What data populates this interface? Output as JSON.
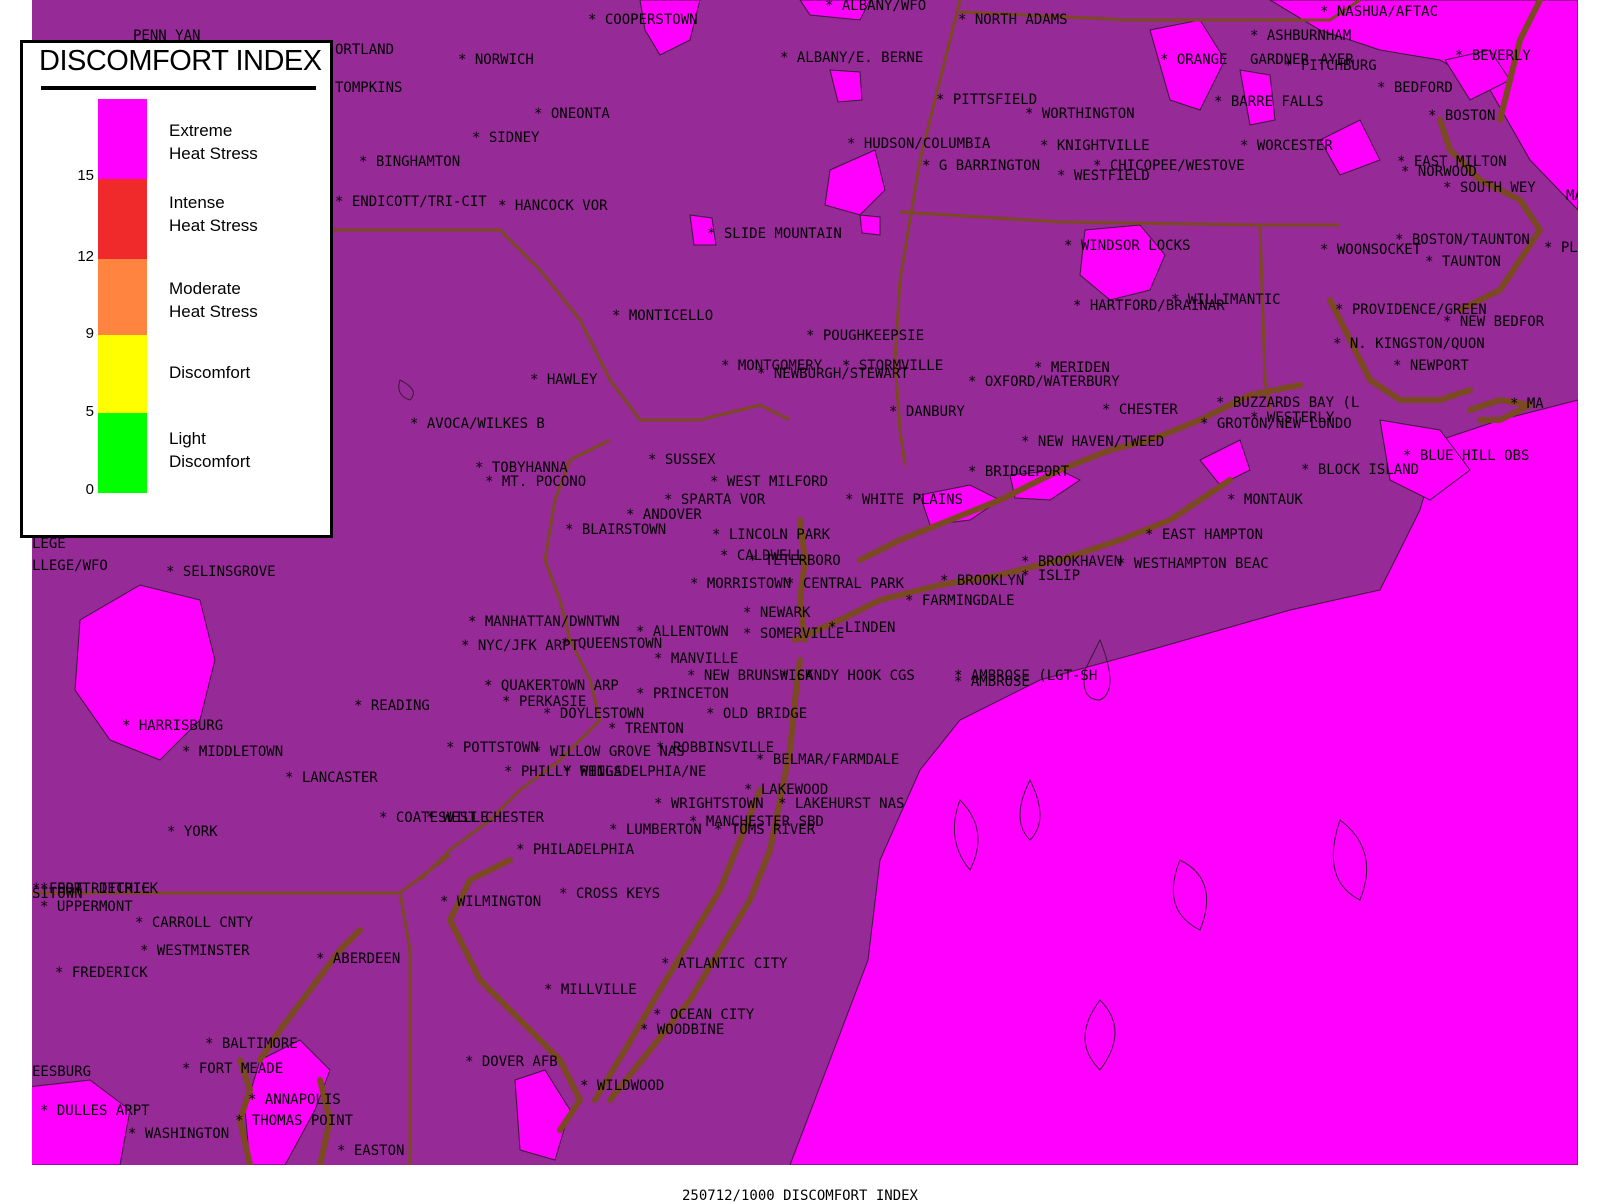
{
  "legend": {
    "title": "DISCOMFORT INDEX",
    "categories": [
      {
        "label": "Extreme\nHeat Stress",
        "color": "#ff00ff"
      },
      {
        "label": "Intense\nHeat Stress",
        "color": "#f02a2a"
      },
      {
        "label": "Moderate\nHeat Stress",
        "color": "#ff8440"
      },
      {
        "label": "Discomfort",
        "color": "#ffff00"
      },
      {
        "label": "Light\nDiscomfort",
        "color": "#00ff00"
      }
    ],
    "ticks": [
      "15",
      "12",
      "9",
      "5",
      "0"
    ]
  },
  "colors": {
    "background_level": "#962a96",
    "extreme_level": "#ff00ff",
    "state_borders": "#7a4a20",
    "coastline": "#7a4a20"
  },
  "caption": "250712/1000 DISCOMFORT INDEX",
  "stations": [
    {
      "name": "PENN YAN",
      "marker": false
    },
    {
      "name": "COOPERSTOWN",
      "marker": true
    },
    {
      "name": "ALBANY/WFO",
      "marker": true
    },
    {
      "name": "NORTH ADAMS",
      "marker": true
    },
    {
      "name": "NASHUA/AFTAC",
      "marker": true
    },
    {
      "name": "ASHBURNHAM",
      "marker": true
    },
    {
      "name": "ORTLAND",
      "marker": false
    },
    {
      "name": "NORWICH",
      "marker": true
    },
    {
      "name": "ALBANY/E. BERNE",
      "marker": true
    },
    {
      "name": "ORANGE",
      "marker": true
    },
    {
      "name": "GARDNER",
      "marker": false
    },
    {
      "name": "AYER",
      "marker": false
    },
    {
      "name": "FITCHBURG",
      "marker": true
    },
    {
      "name": "BEVERLY",
      "marker": true
    },
    {
      "name": "TOMPKINS",
      "marker": false
    },
    {
      "name": "BEDFORD",
      "marker": true
    },
    {
      "name": "PITTSFIELD",
      "marker": true
    },
    {
      "name": "BARRE FALLS",
      "marker": true
    },
    {
      "name": "ONEONTA",
      "marker": true
    },
    {
      "name": "WORTHINGTON",
      "marker": true
    },
    {
      "name": "BOSTON",
      "marker": true
    },
    {
      "name": "SIDNEY",
      "marker": true
    },
    {
      "name": "HUDSON/COLUMBIA",
      "marker": true
    },
    {
      "name": "KNIGHTVILLE",
      "marker": true
    },
    {
      "name": "WORCESTER",
      "marker": true
    },
    {
      "name": "BINGHAMTON",
      "marker": true
    },
    {
      "name": "G BARRINGTON",
      "marker": true
    },
    {
      "name": "CHICOPEE/WESTOVE",
      "marker": true
    },
    {
      "name": "EAST MILTON",
      "marker": true
    },
    {
      "name": "NORWOOD",
      "marker": true
    },
    {
      "name": "WESTFIELD",
      "marker": true
    },
    {
      "name": "SOUTH WEY",
      "marker": true
    },
    {
      "name": "ENDICOTT/TRI-CIT",
      "marker": true
    },
    {
      "name": "HANCOCK VOR",
      "marker": true
    },
    {
      "name": "MAR",
      "marker": false
    },
    {
      "name": "SLIDE MOUNTAIN",
      "marker": true
    },
    {
      "name": "BOSTON/TAUNTON",
      "marker": true
    },
    {
      "name": "PLYM",
      "marker": true
    },
    {
      "name": "WINDSOR LOCKS",
      "marker": true
    },
    {
      "name": "WOONSOCKET",
      "marker": true
    },
    {
      "name": "TAUNTON",
      "marker": true
    },
    {
      "name": "HARTFORD/BRAINAR",
      "marker": true
    },
    {
      "name": "WILLIMANTIC",
      "marker": true
    },
    {
      "name": "PROVIDENCE/GREEN",
      "marker": true
    },
    {
      "name": "MONTICELLO",
      "marker": true
    },
    {
      "name": "NEW BEDFOR",
      "marker": true
    },
    {
      "name": "POUGHKEEPSIE",
      "marker": true
    },
    {
      "name": "N. KINGSTON/QUON",
      "marker": true
    },
    {
      "name": "MONTGOMERY",
      "marker": true
    },
    {
      "name": "STORMVILLE",
      "marker": true
    },
    {
      "name": "NEWPORT",
      "marker": true
    },
    {
      "name": "NEWBURGH/STEWART",
      "marker": true
    },
    {
      "name": "MERIDEN",
      "marker": true
    },
    {
      "name": "HAWLEY",
      "marker": true
    },
    {
      "name": "OXFORD/WATERBURY",
      "marker": true
    },
    {
      "name": "BUZZARDS BAY (L",
      "marker": true
    },
    {
      "name": "MA",
      "marker": true
    },
    {
      "name": "DANBURY",
      "marker": true
    },
    {
      "name": "CHESTER",
      "marker": true
    },
    {
      "name": "WESTERLY",
      "marker": true
    },
    {
      "name": "AVOCA/WILKES B",
      "marker": true
    },
    {
      "name": "GROTON/NEW LONDO",
      "marker": true
    },
    {
      "name": "NEW HAVEN/TWEED",
      "marker": true
    },
    {
      "name": "BLUE HILL OBS",
      "marker": true
    },
    {
      "name": "TOBYHANNA",
      "marker": true
    },
    {
      "name": "SUSSEX",
      "marker": true
    },
    {
      "name": "BRIDGEPORT",
      "marker": true
    },
    {
      "name": "BLOCK ISLAND",
      "marker": true
    },
    {
      "name": "MT. POCONO",
      "marker": true
    },
    {
      "name": "WEST MILFORD",
      "marker": true
    },
    {
      "name": "SPARTA VOR",
      "marker": true
    },
    {
      "name": "WHITE PLAINS",
      "marker": true
    },
    {
      "name": "MONTAUK",
      "marker": true
    },
    {
      "name": "ANDOVER",
      "marker": true
    },
    {
      "name": "BLAIRSTOWN",
      "marker": true
    },
    {
      "name": "LINCOLN PARK",
      "marker": true
    },
    {
      "name": "EAST HAMPTON",
      "marker": true
    },
    {
      "name": "CALDWELL",
      "marker": true
    },
    {
      "name": "TETERBORO",
      "marker": true
    },
    {
      "name": "BROOKHAVEN",
      "marker": true
    },
    {
      "name": "WESTHAMPTON BEAC",
      "marker": true
    },
    {
      "name": "LEGE",
      "marker": false
    },
    {
      "name": "LLEGE/WFO",
      "marker": false
    },
    {
      "name": "SELINSGROVE",
      "marker": true
    },
    {
      "name": "ISLIP",
      "marker": true
    },
    {
      "name": "MORRISTOWN",
      "marker": true
    },
    {
      "name": "CENTRAL PARK",
      "marker": true
    },
    {
      "name": "BROOKLYN",
      "marker": true
    },
    {
      "name": "FARMINGDALE",
      "marker": true
    },
    {
      "name": "NEWARK",
      "marker": true
    },
    {
      "name": "MANHATTAN/DWNTWN",
      "marker": true
    },
    {
      "name": "ALLENTOWN",
      "marker": true
    },
    {
      "name": "SOMERVILLE",
      "marker": true
    },
    {
      "name": "LINDEN",
      "marker": true
    },
    {
      "name": "NYC/JFK ARPT",
      "marker": true
    },
    {
      "name": "QUEENSTOWN",
      "marker": true
    },
    {
      "name": "MANVILLE",
      "marker": true
    },
    {
      "name": "NEW BRUNSWICK",
      "marker": true
    },
    {
      "name": "SANDY HOOK CGS",
      "marker": true
    },
    {
      "name": "AMBROSE (LGT-SH",
      "marker": true
    },
    {
      "name": "AMBROSE",
      "marker": true
    },
    {
      "name": "QUAKERTOWN ARP",
      "marker": true
    },
    {
      "name": "PERKASIE",
      "marker": true
    },
    {
      "name": "PRINCETON",
      "marker": true
    },
    {
      "name": "READING",
      "marker": true
    },
    {
      "name": "DOYLESTOWN",
      "marker": true
    },
    {
      "name": "OLD BRIDGE",
      "marker": true
    },
    {
      "name": "HARRISBURG",
      "marker": true
    },
    {
      "name": "TRENTON",
      "marker": true
    },
    {
      "name": "MIDDLETOWN",
      "marker": true
    },
    {
      "name": "POTTSTOWN",
      "marker": true
    },
    {
      "name": "WILLOW GROVE NAS",
      "marker": true
    },
    {
      "name": "ROBBINSVILLE",
      "marker": true
    },
    {
      "name": "BELMAR/FARMDALE",
      "marker": true
    },
    {
      "name": "PHILLY WINGS F",
      "marker": true
    },
    {
      "name": "LANCASTER",
      "marker": true
    },
    {
      "name": "PHILADELPHIA/NE",
      "marker": true
    },
    {
      "name": "LAKEWOOD",
      "marker": true
    },
    {
      "name": "WRIGHTSTOWN",
      "marker": true
    },
    {
      "name": "LAKEHURST NAS",
      "marker": true
    },
    {
      "name": "COATESVILLE",
      "marker": true
    },
    {
      "name": "WEST CHESTER",
      "marker": true
    },
    {
      "name": "MANCHESTER SBD",
      "marker": true
    },
    {
      "name": "YORK",
      "marker": true
    },
    {
      "name": "LUMBERTON",
      "marker": true
    },
    {
      "name": "TOMS RIVER",
      "marker": true
    },
    {
      "name": "PHILADELPHIA",
      "marker": true
    },
    {
      "name": "FORT DETRICK",
      "marker": true
    },
    {
      "name": "FORT RITCHIE",
      "marker": true
    },
    {
      "name": "SITOWN",
      "marker": false
    },
    {
      "name": "CROSS KEYS",
      "marker": true
    },
    {
      "name": "UPPERMONT",
      "marker": true
    },
    {
      "name": "WILMINGTON",
      "marker": true
    },
    {
      "name": "CARROLL CNTY",
      "marker": true
    },
    {
      "name": "WESTMINSTER",
      "marker": true
    },
    {
      "name": "ABERDEEN",
      "marker": true
    },
    {
      "name": "ATLANTIC CITY",
      "marker": true
    },
    {
      "name": "FREDERICK",
      "marker": true
    },
    {
      "name": "MILLVILLE",
      "marker": true
    },
    {
      "name": "OCEAN CITY",
      "marker": true
    },
    {
      "name": "WOODBINE",
      "marker": true
    },
    {
      "name": "BALTIMORE",
      "marker": true
    },
    {
      "name": "DOVER AFB",
      "marker": true
    },
    {
      "name": "EESBURG",
      "marker": false
    },
    {
      "name": "FORT MEADE",
      "marker": true
    },
    {
      "name": "WILDWOOD",
      "marker": true
    },
    {
      "name": "ANNAPOLIS",
      "marker": true
    },
    {
      "name": "DULLES ARPT",
      "marker": true
    },
    {
      "name": "THOMAS POINT",
      "marker": true
    },
    {
      "name": "WASHINGTON",
      "marker": true
    },
    {
      "name": "EASTON",
      "marker": true
    }
  ]
}
